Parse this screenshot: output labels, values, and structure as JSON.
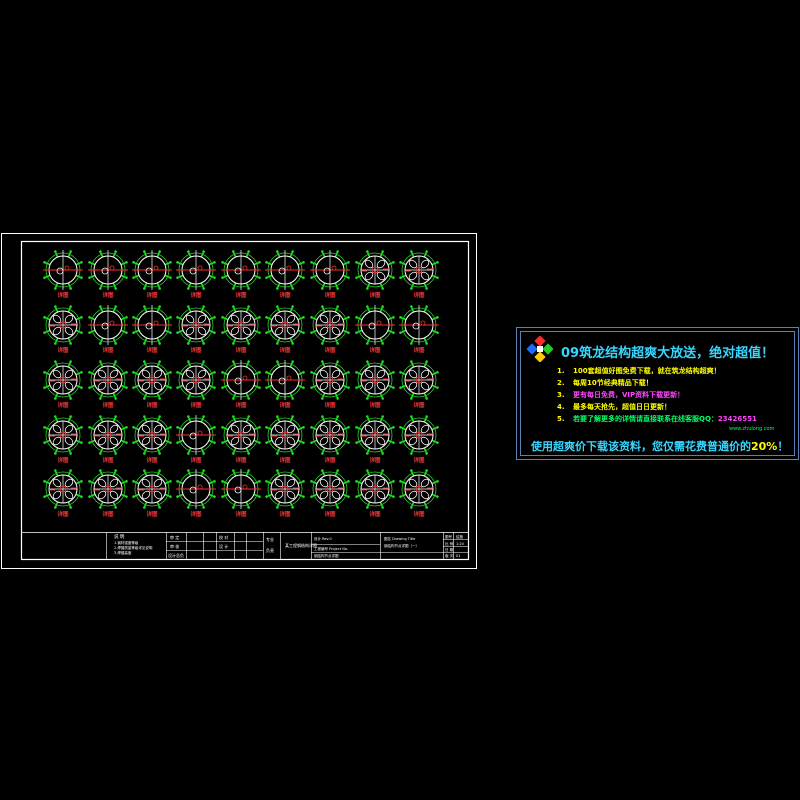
{
  "drawing": {
    "detail_label": "详图",
    "rows": 5,
    "cols": 9,
    "blanks": [
      [
        0,
        0
      ],
      [
        0,
        1
      ],
      [
        0,
        2
      ],
      [
        0,
        3
      ],
      [
        0,
        4
      ],
      [
        0,
        5
      ],
      [
        0,
        6
      ],
      [
        1,
        1
      ],
      [
        1,
        2
      ],
      [
        1,
        7
      ],
      [
        1,
        8
      ],
      [
        2,
        4
      ],
      [
        2,
        5
      ],
      [
        3,
        3
      ],
      [
        4,
        3
      ],
      [
        4,
        4
      ]
    ],
    "colors": {
      "frame": "#ffffff",
      "symbol": "#ffffff",
      "accent_red": "#ff2a2a",
      "accent_green": "#22dd22",
      "label": "#ff3a3a"
    }
  },
  "title_block": {
    "notes_title": "说 明",
    "note_1": "1.钢材强度等级",
    "note_2": "2.焊缝质量等级详见说明",
    "note_3": "3.焊缝高度",
    "col_a1": "审 定",
    "col_a2": "审 核",
    "col_a3": "设计总负",
    "col_b1": "校 对",
    "col_b2": "设 计",
    "col_c1": "专业",
    "col_c2": "负责",
    "project_label": "某工程钢结构详图",
    "cell_d1": "设计 Rev.0",
    "cell_d2": "工程编号 Project No.",
    "cell_d3": "钢结构节点详图",
    "cell_e1": "图名 Drawing Title",
    "cell_e2": "钢结构节点详图（一）",
    "cell_f1": "图号",
    "cell_f2": "比 例",
    "cell_f3": "日 期",
    "cell_f4": "版 次",
    "cell_g1": "结施",
    "cell_g2": "1:20",
    "cell_g3": "01"
  },
  "ad": {
    "title": "09筑龙结构超爽大放送，绝对超值！",
    "items": [
      {
        "num": "1.",
        "text": "100套超值好图免费下载，就在筑龙结构超爽！",
        "color": "#ffff00"
      },
      {
        "num": "2.",
        "text": "每周10节经典精品下载！",
        "color": "#ffff00"
      },
      {
        "num": "3.",
        "text": "更有每日免费，VIP资料下载更新！",
        "color": "#ff44ff"
      },
      {
        "num": "4.",
        "text": "最多每天抢先，超值日日更新！",
        "color": "#ffff00"
      },
      {
        "num": "5.",
        "text": "若要了解更多的详情请直接联系在线客服QQ：",
        "color": "#00ff66",
        "highlight": "23426551"
      }
    ],
    "note": "www.zhulong.com",
    "footer_prefix": "使用超爽价下载该资料，您仅需花费普通价的",
    "footer_highlight": "20%",
    "footer_suffix": "！"
  }
}
